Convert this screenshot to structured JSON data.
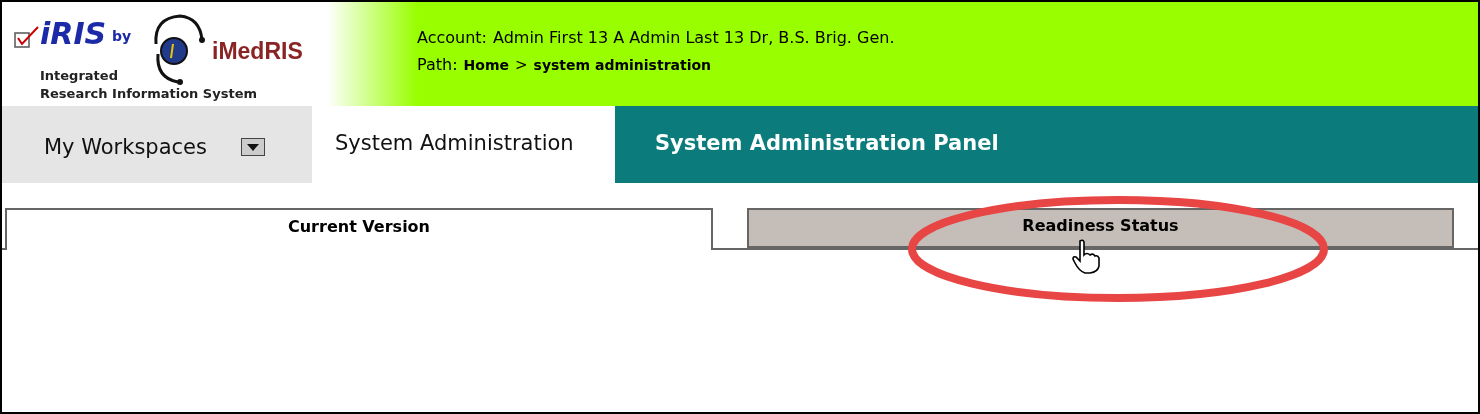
{
  "logo": {
    "product": "iRIS",
    "by": "by",
    "company": "iMedRIS",
    "tagline_1": "Integrated",
    "tagline_2": "Research Information System"
  },
  "header": {
    "account_label": "Account:",
    "account": "Admin First 13 A Admin Last 13 Dr, B.S. Brig. Gen.",
    "path_label": "Path:",
    "path": [
      {
        "label": "Home"
      },
      {
        "label": "system administration"
      }
    ],
    "path_separator": ">"
  },
  "nav": [
    {
      "label": "My Workspaces",
      "selected": false,
      "dropdown": true
    },
    {
      "label": "System Administration",
      "selected": true,
      "dropdown": false
    }
  ],
  "panel_title": "System Administration Panel",
  "tabs": [
    {
      "label": "Current Version",
      "selected": true
    },
    {
      "label": "Readiness Status",
      "selected": false,
      "highlighted": true
    }
  ]
}
